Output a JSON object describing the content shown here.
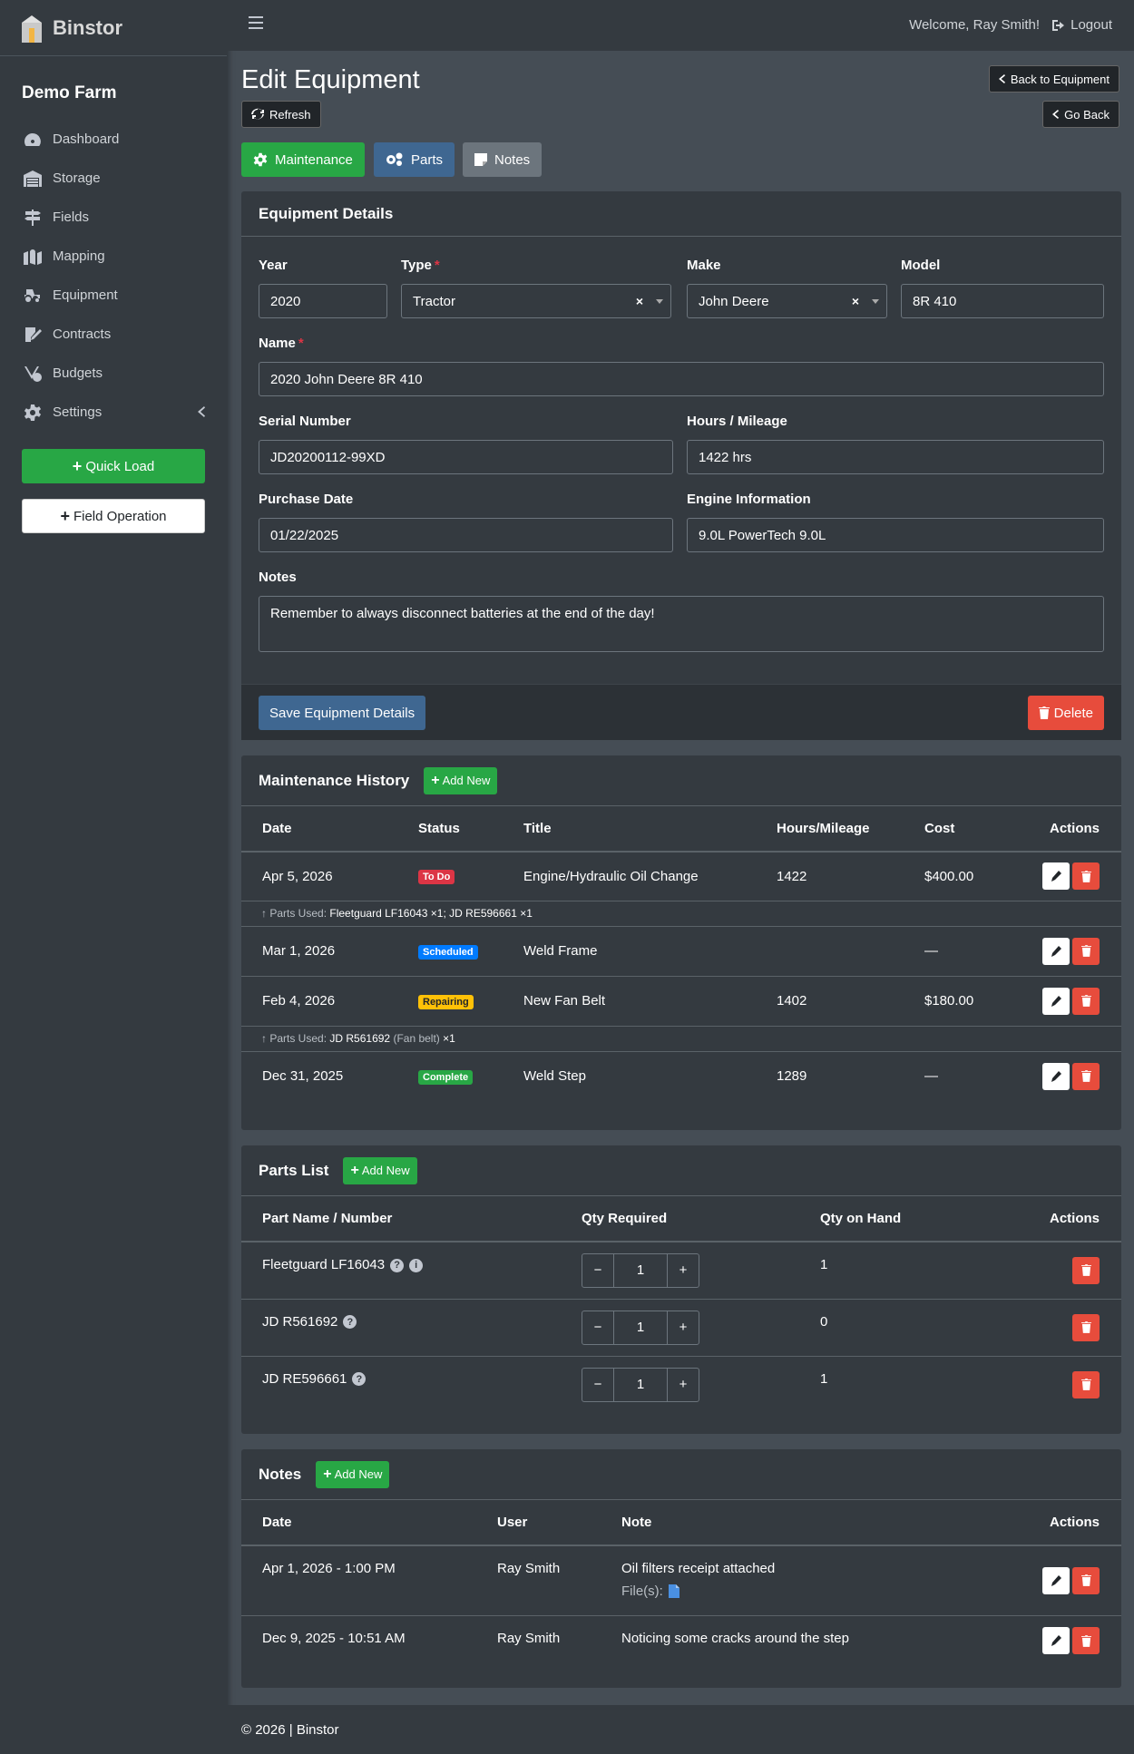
{
  "brand": {
    "name": "Binstor"
  },
  "sidebar": {
    "farm_name": "Demo Farm",
    "items": [
      {
        "label": "Dashboard",
        "icon": "dashboard-icon"
      },
      {
        "label": "Storage",
        "icon": "warehouse-icon"
      },
      {
        "label": "Fields",
        "icon": "signpost-icon"
      },
      {
        "label": "Mapping",
        "icon": "map-icon"
      },
      {
        "label": "Equipment",
        "icon": "tractor-icon"
      },
      {
        "label": "Contracts",
        "icon": "contract-icon"
      },
      {
        "label": "Budgets",
        "icon": "budget-icon"
      },
      {
        "label": "Settings",
        "icon": "gear-icon"
      }
    ],
    "quick_load": "Quick Load",
    "field_operation": "Field Operation"
  },
  "topbar": {
    "welcome": "Welcome, Ray Smith!",
    "logout": "Logout"
  },
  "page": {
    "title": "Edit Equipment",
    "refresh": "Refresh",
    "back_to_equipment": "Back to Equipment",
    "go_back": "Go Back"
  },
  "tabs": {
    "maintenance": "Maintenance",
    "parts": "Parts",
    "notes": "Notes"
  },
  "details": {
    "header": "Equipment Details",
    "year_label": "Year",
    "year": "2020",
    "type_label": "Type",
    "type": "Tractor",
    "make_label": "Make",
    "make": "John Deere",
    "model_label": "Model",
    "model": "8R 410",
    "name_label": "Name",
    "name": "2020 John Deere 8R 410",
    "serial_label": "Serial Number",
    "serial": "JD20200112-99XD",
    "hours_label": "Hours / Mileage",
    "hours": "1422 hrs",
    "purchase_label": "Purchase Date",
    "purchase": "01/22/2025",
    "engine_label": "Engine Information",
    "engine": "9.0L PowerTech 9.0L",
    "notes_label": "Notes",
    "notes": "Remember to always disconnect batteries at the end of the day!",
    "save": "Save Equipment Details",
    "delete": "Delete",
    "req_mark": "*",
    "clear_mark": "×"
  },
  "maintenance": {
    "header": "Maintenance History",
    "add_new": "Add New",
    "columns": [
      "Date",
      "Status",
      "Title",
      "Hours/Mileage",
      "Cost",
      "Actions"
    ],
    "parts_used_label": "Parts Used:",
    "rows": [
      {
        "date": "Apr 5, 2026",
        "status": "To Do",
        "title": "Engine/Hydraulic Oil Change",
        "hours": "1422",
        "cost": "$400.00",
        "parts_used": "Fleetguard LF16043 ×1; JD RE596661 ×1"
      },
      {
        "date": "Mar 1, 2026",
        "status": "Scheduled",
        "title": "Weld Frame",
        "hours": "",
        "cost": "—"
      },
      {
        "date": "Feb 4, 2026",
        "status": "Repairing",
        "title": "New Fan Belt",
        "hours": "1402",
        "cost": "$180.00",
        "parts_used_a": "JD R561692",
        "parts_used_b": "(Fan belt)",
        "parts_used_c": "×1"
      },
      {
        "date": "Dec 31, 2025",
        "status": "Complete",
        "title": "Weld Step",
        "hours": "1289",
        "cost": "—"
      }
    ],
    "status_colors": {
      "To Do": "#dc3545",
      "Scheduled": "#007bff",
      "Repairing": "#ffc107",
      "Complete": "#28a745"
    }
  },
  "parts": {
    "header": "Parts List",
    "add_new": "Add New",
    "columns": [
      "Part Name / Number",
      "Qty Required",
      "Qty on Hand",
      "Actions"
    ],
    "rows": [
      {
        "name": "Fleetguard LF16043",
        "qty_required": "1",
        "qty_on_hand": "1"
      },
      {
        "name": "JD R561692",
        "qty_required": "1",
        "qty_on_hand": "0"
      },
      {
        "name": "JD RE596661",
        "qty_required": "1",
        "qty_on_hand": "1"
      }
    ],
    "minus": "−",
    "plus": "+",
    "help_mark": "?",
    "info_mark": "i"
  },
  "notes": {
    "header": "Notes",
    "add_new": "Add New",
    "columns": [
      "Date",
      "User",
      "Note",
      "Actions"
    ],
    "files_label": "File(s):",
    "rows": [
      {
        "date": "Apr 1, 2026 - 1:00 PM",
        "user": "Ray Smith",
        "note": "Oil filters receipt attached"
      },
      {
        "date": "Dec 9, 2025 - 10:51 AM",
        "user": "Ray Smith",
        "note": "Noticing some cracks around the step"
      }
    ]
  },
  "footer": {
    "text": "© 2026 | Binstor"
  },
  "colors": {
    "success": "#28a745",
    "primary_dark": "#3f6791",
    "danger": "#e74c3c",
    "sidebar": "#343a40",
    "content": "#454d55"
  }
}
